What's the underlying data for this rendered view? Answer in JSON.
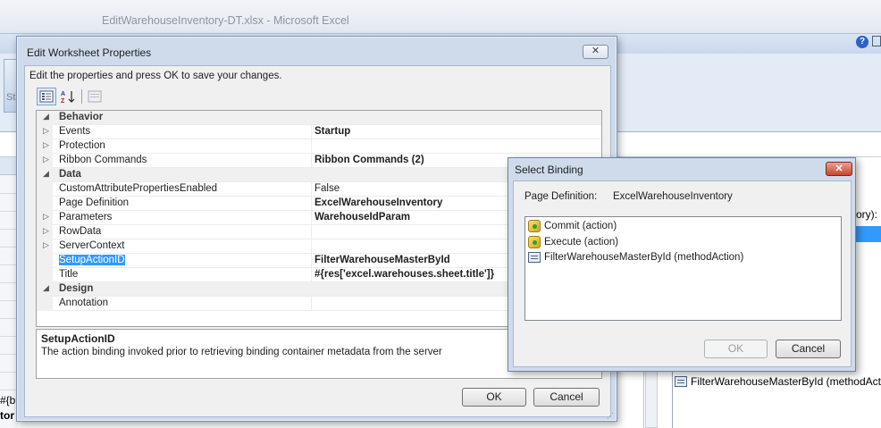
{
  "excel": {
    "window_title": "EditWarehouseInventory-DT.xlsx - Microsoft Excel",
    "left_fragment": "St",
    "right_fragment": "ory):",
    "right_item": "FilterWarehouseMasterById (methodActio",
    "cell_fragment_1": "#{b",
    "cell_fragment_2": "tor",
    "help_icon": "?"
  },
  "properties_dialog": {
    "title": "Edit Worksheet Properties",
    "close_glyph": "✕",
    "instruction": "Edit the properties and press OK to save your changes.",
    "toolbar": {
      "categorized_icon": "categorized-icon",
      "alphabetical_icon": "sort-az-icon",
      "property_pages_icon": "property-pages-icon"
    },
    "rows": [
      {
        "type": "category",
        "name": "Behavior",
        "expander": "◢"
      },
      {
        "type": "property",
        "name": "Events",
        "value": "Startup",
        "bold": true,
        "expander": "▷"
      },
      {
        "type": "property",
        "name": "Protection",
        "value": "",
        "bold": false,
        "expander": "▷"
      },
      {
        "type": "property",
        "name": "Ribbon Commands",
        "value": "Ribbon Commands (2)",
        "bold": true,
        "expander": "▷"
      },
      {
        "type": "category",
        "name": "Data",
        "expander": "◢"
      },
      {
        "type": "property",
        "name": "CustomAttributePropertiesEnabled",
        "value": "False",
        "bold": false,
        "expander": ""
      },
      {
        "type": "property",
        "name": "Page Definition",
        "value": "ExcelWarehouseInventory",
        "bold": true,
        "expander": ""
      },
      {
        "type": "property",
        "name": "Parameters",
        "value": "WarehouseIdParam",
        "bold": true,
        "expander": "▷"
      },
      {
        "type": "property",
        "name": "RowData",
        "value": "",
        "bold": false,
        "expander": "▷"
      },
      {
        "type": "property",
        "name": "ServerContext",
        "value": "",
        "bold": false,
        "expander": "▷"
      },
      {
        "type": "property",
        "name": "SetupActionID",
        "value": "FilterWarehouseMasterById",
        "bold": true,
        "expander": ""
      },
      {
        "type": "property",
        "name": "Title",
        "value": "#{res['excel.warehouses.sheet.title']}",
        "bold": true,
        "expander": ""
      },
      {
        "type": "category",
        "name": "Design",
        "expander": "◢"
      },
      {
        "type": "property",
        "name": "Annotation",
        "value": "",
        "bold": false,
        "expander": ""
      }
    ],
    "description": {
      "title": "SetupActionID",
      "text": "The action binding invoked prior to retrieving binding container metadata from the server"
    },
    "ok_label": "OK",
    "cancel_label": "Cancel"
  },
  "select_binding_dialog": {
    "title": "Select Binding",
    "close_glyph": "✕",
    "page_definition_label": "Page Definition:",
    "page_definition_value": "ExcelWarehouseInventory",
    "items": [
      {
        "label": "Commit (action)",
        "icon": "action-icon"
      },
      {
        "label": "Execute (action)",
        "icon": "action-icon"
      },
      {
        "label": "FilterWarehouseMasterById (methodAction)",
        "icon": "method-action-icon"
      }
    ],
    "ok_label": "OK",
    "cancel_label": "Cancel"
  }
}
